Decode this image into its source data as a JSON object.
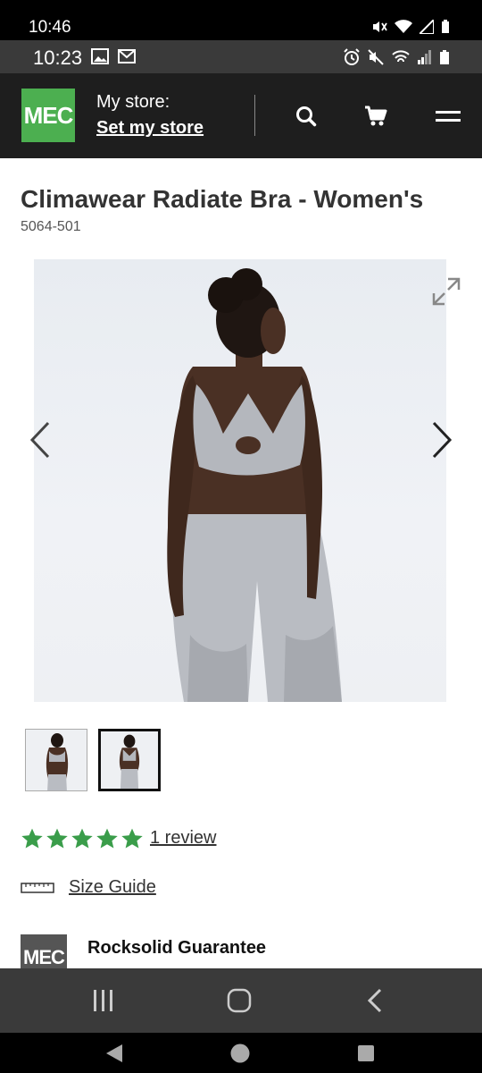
{
  "outer_status": {
    "time": "10:46"
  },
  "inner_status": {
    "time": "10:23"
  },
  "header": {
    "logo": "MEC",
    "store_label": "My store:",
    "store_link": "Set my store"
  },
  "product": {
    "title": "Climawear Radiate Bra - Women's",
    "sku": "5064-501",
    "rating_value": 5,
    "rating_max": 5,
    "review_link": "1 review",
    "size_guide": "Size Guide",
    "guarantee_logo": "MEC",
    "guarantee_title": "Rocksolid Guarantee"
  },
  "colors": {
    "brand_green": "#4caf50",
    "header_bg": "#1e1e1e",
    "star_green": "#3a9d4a"
  },
  "icons": {
    "search": "search-icon",
    "cart": "cart-icon",
    "menu": "hamburger-menu-icon",
    "expand": "expand-icon",
    "prev": "chevron-left-icon",
    "next": "chevron-right-icon",
    "ruler": "ruler-icon"
  }
}
